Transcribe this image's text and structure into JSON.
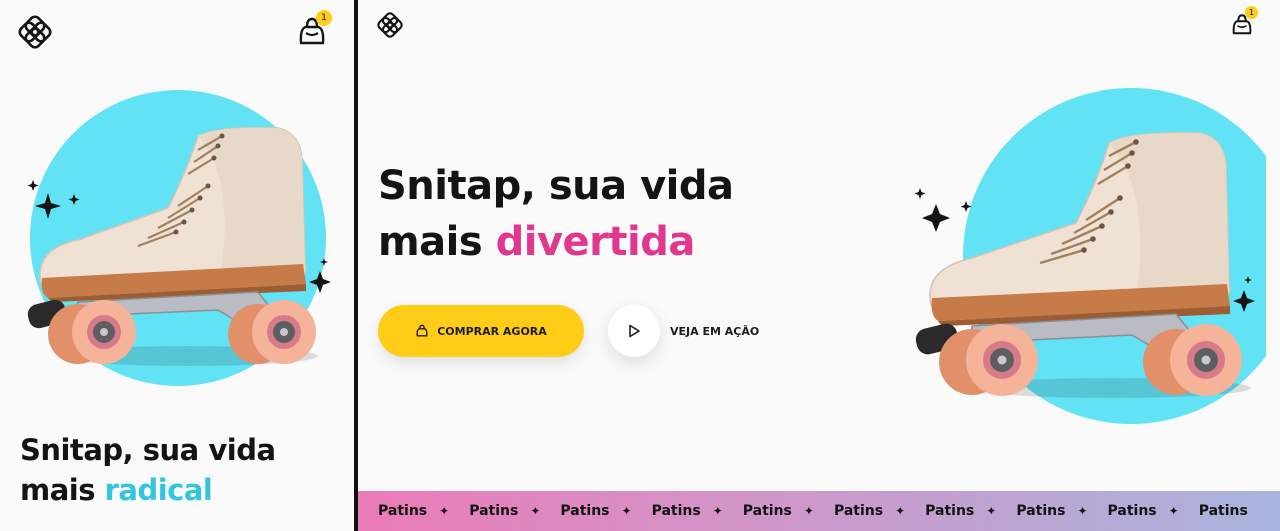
{
  "mobile": {
    "cart_count": "1",
    "title_line1": "Snitap, sua vida",
    "title_line2_prefix": "mais ",
    "title_highlight": "radical",
    "highlight_color": "#33c4e0"
  },
  "desktop": {
    "cart_count": "1",
    "title_line1": "Snitap, sua vida",
    "title_line2_prefix": "mais ",
    "title_highlight": "divertida",
    "highlight_color": "#e0378f",
    "buy_button": "COMPRAR AGORA",
    "watch_button": "VEJA EM AÇÃO",
    "marquee_items": [
      "Patins",
      "Patins",
      "Patins",
      "Patins",
      "Patins",
      "Patins",
      "Patins",
      "Patins",
      "Patins",
      "Patins"
    ]
  },
  "colors": {
    "accent_yellow": "#ffcc17",
    "circle_cyan": "#62e2f5",
    "marquee_pink": "#ec7bb8",
    "marquee_blue": "#a8b4dd"
  },
  "icons": {
    "logo": "snitap-logo-icon",
    "cart": "shopping-bag-icon",
    "play": "play-icon",
    "sparkle": "sparkle-icon"
  }
}
